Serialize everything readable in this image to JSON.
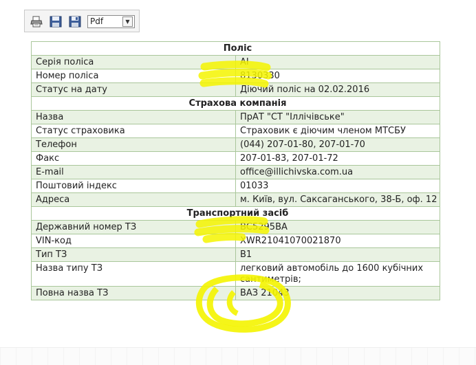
{
  "toolbar": {
    "print_icon": "printer-icon",
    "save_icon": "floppy-disk-icon",
    "save_as_icon": "floppy-disk-alt-icon",
    "format_value": "Pdf"
  },
  "sections": [
    {
      "title": "Поліс",
      "rows": [
        {
          "label": "Серія поліса",
          "value": "АІ"
        },
        {
          "label": "Номер поліса",
          "value": "8130330"
        },
        {
          "label": "Статус на дату",
          "value": "Діючий поліс на 02.02.2016"
        }
      ]
    },
    {
      "title": "Страхова компанія",
      "rows": [
        {
          "label": "Назва",
          "value": "ПрАТ \"СТ \"Іллічівське\""
        },
        {
          "label": "Статус страховика",
          "value": "Страховик є діючим членом МТСБУ"
        },
        {
          "label": "Телефон",
          "value": "(044) 207-01-80, 207-01-70"
        },
        {
          "label": "Факс",
          "value": "207-01-83, 207-01-72"
        },
        {
          "label": "E-mail",
          "value": "office@illichivska.com.ua"
        },
        {
          "label": "Поштовий індекс",
          "value": "01033"
        },
        {
          "label": "Адреса",
          "value": "м. Київ, вул. Саксаганського, 38-Б, оф. 12"
        }
      ]
    },
    {
      "title": "Транспортний засіб",
      "rows": [
        {
          "label": "Державний номер ТЗ",
          "value": "ВС5295ВА"
        },
        {
          "label": "VIN-код",
          "value": "XWR21041070021870"
        },
        {
          "label": "Тип ТЗ",
          "value": "В1"
        },
        {
          "label": "Назва типу ТЗ",
          "value": "легковий автомобіль до 1600 кубічних сантиметрів;"
        },
        {
          "label": "Повна назва ТЗ",
          "value": "ВАЗ 21043"
        }
      ]
    }
  ],
  "colors": {
    "odd_row": "#e9f2e3",
    "border": "#a9c69a",
    "highlighter": "#f4f400"
  }
}
